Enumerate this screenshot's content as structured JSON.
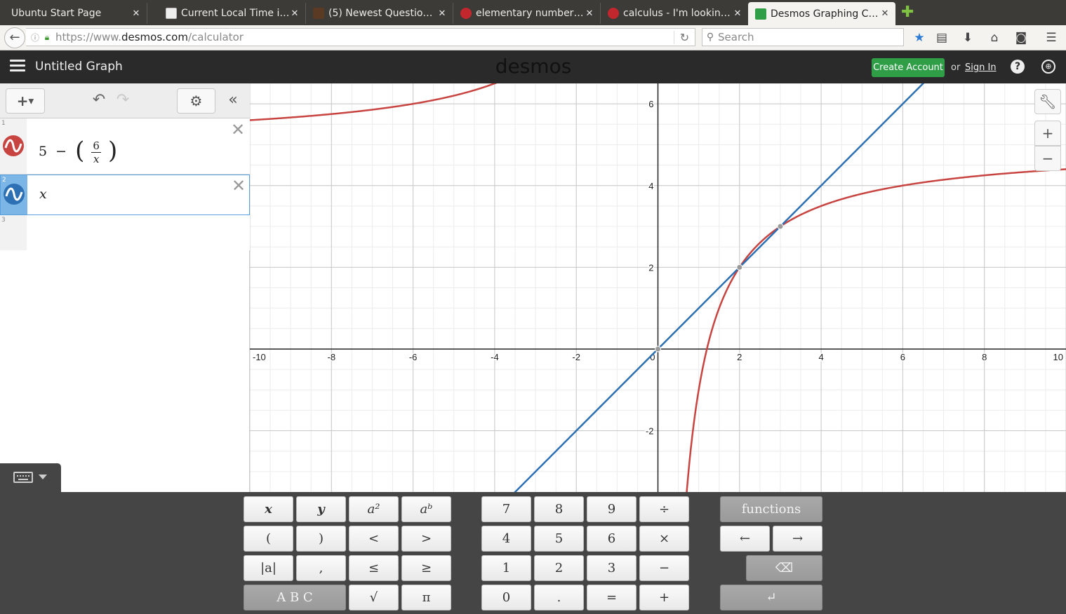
{
  "browser": {
    "tabs": [
      {
        "title": "Ubuntu Start Page",
        "favicon_color": "#3c3b37"
      },
      {
        "title": "Current Local Time i…",
        "favicon_color": "#e8e8e8"
      },
      {
        "title": "(5) Newest Question…",
        "favicon_color": "#5a3a22"
      },
      {
        "title": "elementary number …",
        "favicon_color": "#c1272d"
      },
      {
        "title": "calculus - I'm lookin…",
        "favicon_color": "#c1272d"
      },
      {
        "title": "Desmos Graphing C…",
        "favicon_color": "#2f9e47"
      }
    ],
    "active_tab": 5,
    "new_tab_glyph": "✚",
    "back_glyph": "←",
    "url_prefix": "https://www.",
    "url_domain": "desmos.com",
    "url_path": "/calculator",
    "search_placeholder": "Search",
    "toolbar_icons": [
      "star-icon",
      "reading-list-icon",
      "download-icon",
      "home-icon",
      "pocket-icon",
      "menu-icon"
    ]
  },
  "desmos": {
    "graph_title": "Untitled Graph",
    "logo": "desmos",
    "create_account": "Create Account",
    "or": "or",
    "sign_in": "Sign In",
    "help_glyph": "?",
    "expressions": [
      {
        "number": "1",
        "color": "#c74440",
        "latex": "5-\\left(\\frac{6}{x}\\right)"
      },
      {
        "number": "2",
        "color": "#2d70b3",
        "latex": "x"
      },
      {
        "number": "3",
        "color": "",
        "latex": ""
      }
    ]
  },
  "graph": {
    "x_range": [
      -10,
      10
    ],
    "y_range": [
      -3.5,
      6.5
    ],
    "major_step": 2,
    "minor_step": 0.5,
    "x_ticks": [
      "-10",
      "-8",
      "-6",
      "-4",
      "-2",
      "0",
      "2",
      "4",
      "6",
      "8",
      "10"
    ],
    "y_ticks": [
      "6",
      "4",
      "2",
      "-2"
    ],
    "curves": [
      {
        "name": "5 - (6/x)",
        "color": "#c74440"
      },
      {
        "name": "x",
        "color": "#2d70b3"
      }
    ],
    "points": [
      [
        0,
        0
      ],
      [
        2,
        2
      ],
      [
        3,
        3
      ]
    ]
  },
  "keypad": {
    "rows": [
      [
        "x",
        "y",
        "a²",
        "aᵇ",
        "7",
        "8",
        "9",
        "÷",
        "functions"
      ],
      [
        "(",
        ")",
        "<",
        ">",
        "4",
        "5",
        "6",
        "×",
        "←",
        "→"
      ],
      [
        "|a|",
        ",",
        "≤",
        "≥",
        "1",
        "2",
        "3",
        "−",
        "⌫"
      ],
      [
        "A B C",
        "√",
        "π",
        "0",
        ".",
        "=",
        "+",
        "↵"
      ]
    ]
  }
}
